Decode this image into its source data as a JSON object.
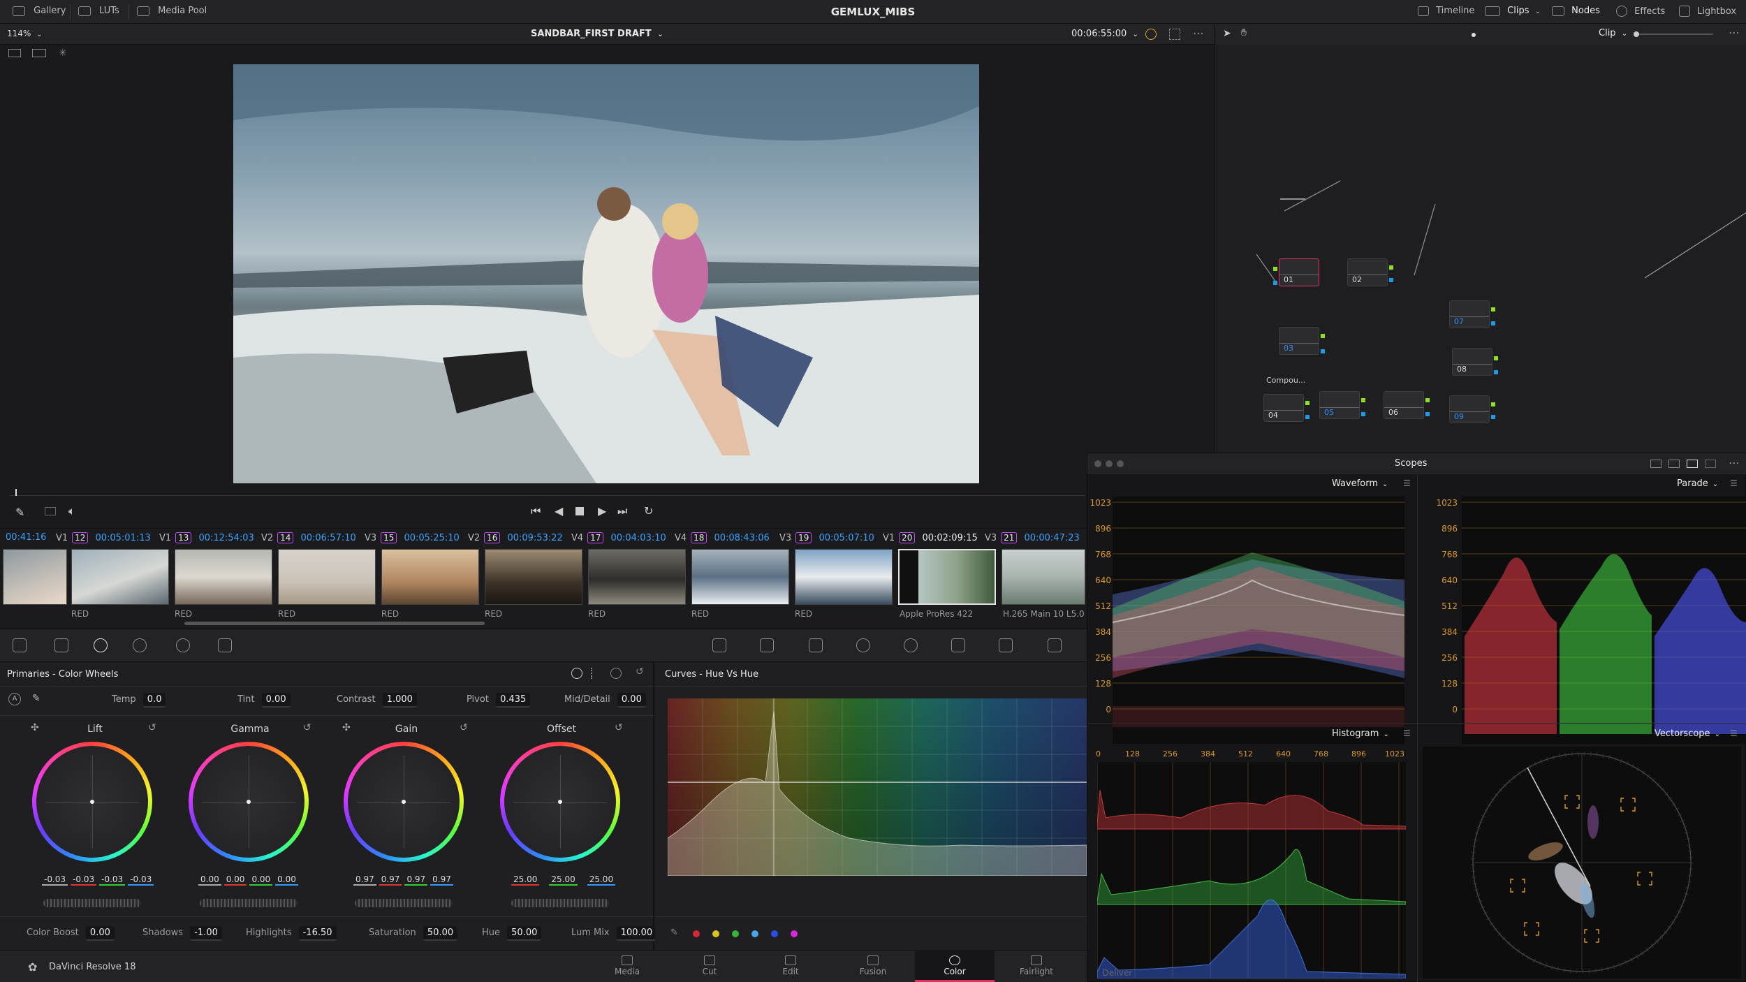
{
  "topbar": {
    "left_tabs": [
      "Gallery",
      "LUTs",
      "Media Pool"
    ],
    "project_title": "GEMLUX_MIBS",
    "right_tabs": [
      "Timeline",
      "Clips",
      "Nodes",
      "Effects",
      "Lightbox"
    ]
  },
  "viewer": {
    "zoom": "114%",
    "timeline_name": "SANDBAR_FIRST DRAFT",
    "timecode": "00:06:55:00",
    "clip_mode": "Clip"
  },
  "clips": [
    {
      "tc": "00:41:16",
      "track": "",
      "num": "",
      "codec": ""
    },
    {
      "tc": "00:05:01:13",
      "track": "V1",
      "num": "12",
      "codec": "RED"
    },
    {
      "tc": "00:12:54:03",
      "track": "V1",
      "num": "13",
      "codec": "RED"
    },
    {
      "tc": "00:06:57:10",
      "track": "V2",
      "num": "14",
      "codec": "RED"
    },
    {
      "tc": "00:05:25:10",
      "track": "V3",
      "num": "15",
      "codec": "RED"
    },
    {
      "tc": "00:09:53:22",
      "track": "V2",
      "num": "16",
      "codec": "RED"
    },
    {
      "tc": "00:04:03:10",
      "track": "V4",
      "num": "17",
      "codec": "RED"
    },
    {
      "tc": "00:08:43:06",
      "track": "V4",
      "num": "18",
      "codec": "RED"
    },
    {
      "tc": "00:05:07:10",
      "track": "V3",
      "num": "19",
      "codec": "RED"
    },
    {
      "tc": "00:02:09:15",
      "track": "V1",
      "num": "20",
      "codec": "Apple ProRes 422"
    },
    {
      "tc": "00:00:47:23",
      "track": "V3",
      "num": "21",
      "codec": "H.265 Main 10 L5.0"
    }
  ],
  "primaries": {
    "title": "Primaries - Color Wheels",
    "temp_label": "Temp",
    "temp": "0.0",
    "tint_label": "Tint",
    "tint": "0.00",
    "contrast_label": "Contrast",
    "contrast": "1.000",
    "pivot_label": "Pivot",
    "pivot": "0.435",
    "middetail_label": "Mid/Detail",
    "middetail": "0.00",
    "wheels": [
      {
        "name": "Lift",
        "vals": [
          "-0.03",
          "-0.03",
          "-0.03",
          "-0.03"
        ]
      },
      {
        "name": "Gamma",
        "vals": [
          "0.00",
          "0.00",
          "0.00",
          "0.00"
        ]
      },
      {
        "name": "Gain",
        "vals": [
          "0.97",
          "0.97",
          "0.97",
          "0.97"
        ]
      },
      {
        "name": "Offset",
        "vals": [
          "25.00",
          "25.00",
          "25.00"
        ]
      }
    ],
    "colorboost_label": "Color Boost",
    "colorboost": "0.00",
    "shadows_label": "Shadows",
    "shadows": "-1.00",
    "highlights_label": "Highlights",
    "highlights": "-16.50",
    "saturation_label": "Saturation",
    "saturation": "50.00",
    "hue_label": "Hue",
    "hue": "50.00",
    "lummix_label": "Lum Mix",
    "lummix": "100.00"
  },
  "curves": {
    "title": "Curves - Hue Vs Hue"
  },
  "scopes": {
    "title": "Scopes",
    "waveform": "Waveform",
    "parade": "Parade",
    "histogram": "Histogram",
    "vectorscope": "Vectorscope",
    "yticks": [
      "1023",
      "896",
      "768",
      "640",
      "512",
      "384",
      "256",
      "128",
      "0"
    ],
    "hticks": [
      "0",
      "128",
      "256",
      "384",
      "512",
      "640",
      "768",
      "896",
      "1023"
    ]
  },
  "nodes": {
    "labels": [
      "01",
      "02",
      "03",
      "04",
      "05",
      "06",
      "07",
      "08",
      "09"
    ],
    "compound": "Compou..."
  },
  "pages": [
    "Media",
    "Cut",
    "Edit",
    "Fusion",
    "Color",
    "Fairlight",
    "Deliver"
  ],
  "app_name": "DaVinci Resolve 18",
  "colors": {
    "accent_pink": "#e0325c",
    "node_blue": "#2e8fff",
    "scope_orange": "#d89a2b"
  }
}
